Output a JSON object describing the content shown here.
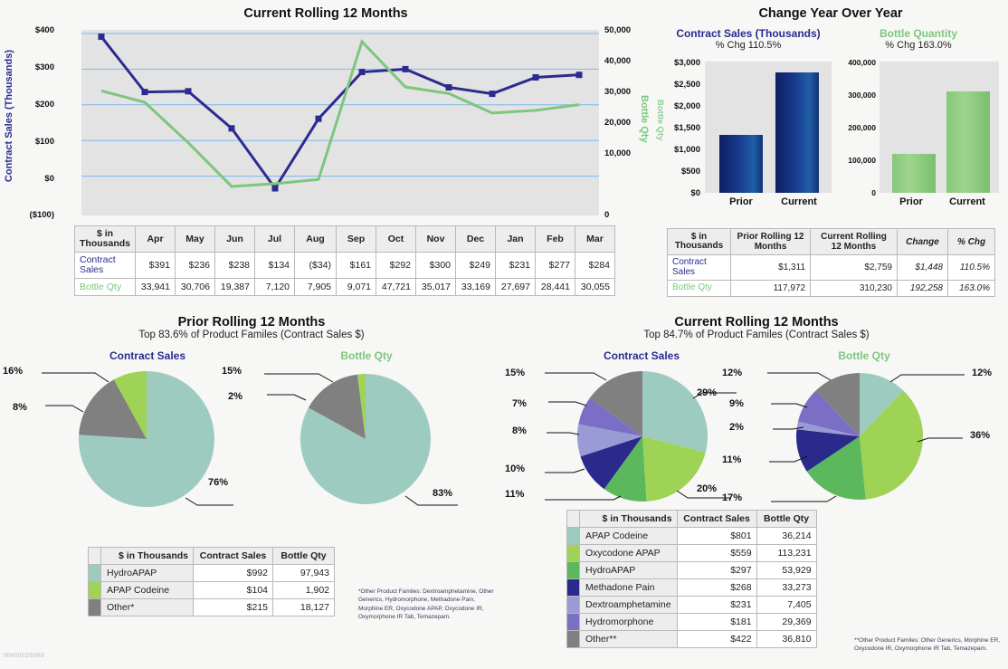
{
  "line_chart": {
    "title": "Current Rolling 12 Months",
    "y_left_label": "Contract Sales (Thousands)",
    "y_right_label": "Bottle Qty",
    "y_left_ticks": [
      "$400",
      "$300",
      "$200",
      "$100",
      "$0",
      "($100)"
    ],
    "y_right_ticks": [
      "50,000",
      "40,000",
      "30,000",
      "20,000",
      "10,000",
      "0"
    ]
  },
  "month_table": {
    "corner": "$ in Thousands",
    "months": [
      "Apr",
      "May",
      "Jun",
      "Jul",
      "Aug",
      "Sep",
      "Oct",
      "Nov",
      "Dec",
      "Jan",
      "Feb",
      "Mar"
    ],
    "rows": [
      {
        "label": "Contract Sales",
        "values": [
          "$391",
          "$236",
          "$238",
          "$134",
          "($34)",
          "$161",
          "$292",
          "$300",
          "$249",
          "$231",
          "$277",
          "$284"
        ]
      },
      {
        "label": "Bottle Qty",
        "values": [
          "33,941",
          "30,706",
          "19,387",
          "7,120",
          "7,905",
          "9,071",
          "47,721",
          "35,017",
          "33,169",
          "27,697",
          "28,441",
          "30,055"
        ]
      }
    ]
  },
  "yoy": {
    "title": "Change Year Over Year",
    "left_chart": {
      "title": "Contract Sales (Thousands)",
      "subtitle": "% Chg 110.5%",
      "ticks": [
        "$3,000",
        "$2,500",
        "$2,000",
        "$1,500",
        "$1,000",
        "$500",
        "$0"
      ],
      "cat_prior": "Prior",
      "cat_current": "Current"
    },
    "right_chart": {
      "title": "Bottle Quantity",
      "subtitle": "% Chg 163.0%",
      "ticks": [
        "400,000",
        "300,000",
        "200,000",
        "100,000",
        "0"
      ],
      "cat_prior": "Prior",
      "cat_current": "Current"
    },
    "side_label": "Bottle Qty",
    "table": {
      "corner": "$ in Thousands",
      "headers": [
        "Prior Rolling 12 Months",
        "Current Rolling 12 Months",
        "Change",
        "% Chg"
      ],
      "rows": [
        {
          "label": "Contract Sales",
          "prior": "$1,311",
          "current": "$2,759",
          "change": "$1,448",
          "pct": "110.5%"
        },
        {
          "label": "Bottle Qty",
          "prior": "117,972",
          "current": "310,230",
          "change": "192,258",
          "pct": "163.0%"
        }
      ]
    }
  },
  "prior": {
    "title": "Prior Rolling 12 Months",
    "subtitle": "Top 83.6% of Product Familes (Contract Sales $)",
    "pie_left_title": "Contract Sales",
    "pie_right_title": "Bottle Qty",
    "labels": {
      "cs_76": "76%",
      "cs_8": "8%",
      "cs_16": "16%",
      "bq_83": "83%",
      "bq_2": "2%",
      "bq_15": "15%"
    },
    "table": {
      "corner": "$ in Thousands",
      "headers": [
        "Contract Sales",
        "Bottle Qty"
      ],
      "rows": [
        {
          "label": "HydroAPAP",
          "sales": "$992",
          "qty": "97,943"
        },
        {
          "label": "APAP Codeine",
          "sales": "$104",
          "qty": "1,902"
        },
        {
          "label": "Other*",
          "sales": "$215",
          "qty": "18,127"
        }
      ]
    },
    "footnote": "*Other Product Familes: Dextroamphetamine, Other Generics, Hydromorphone, Methadone Pain, Morphine ER, Oxycodone APAP, Oxycodone IR, Oxymorphone IR Tab, Temazepam."
  },
  "current": {
    "title": "Current Rolling 12 Months",
    "subtitle": "Top 84.7% of Product Familes (Contract Sales $)",
    "pie_left_title": "Contract Sales",
    "pie_right_title": "Bottle Qty",
    "labels": {
      "cs_29": "29%",
      "cs_20": "20%",
      "cs_11": "11%",
      "cs_10": "10%",
      "cs_8": "8%",
      "cs_7": "7%",
      "cs_15": "15%",
      "bq_12r": "12%",
      "bq_36": "36%",
      "bq_17": "17%",
      "bq_11": "11%",
      "bq_2": "2%",
      "bq_9": "9%",
      "bq_12l": "12%"
    },
    "table": {
      "corner": "$ in Thousands",
      "headers": [
        "Contract Sales",
        "Bottle Qty"
      ],
      "rows": [
        {
          "label": "APAP Codeine",
          "sales": "$801",
          "qty": "36,214"
        },
        {
          "label": "Oxycodone APAP",
          "sales": "$559",
          "qty": "113,231"
        },
        {
          "label": "HydroAPAP",
          "sales": "$297",
          "qty": "53,929"
        },
        {
          "label": "Methadone Pain",
          "sales": "$268",
          "qty": "33,273"
        },
        {
          "label": "Dextroamphetamine",
          "sales": "$231",
          "qty": "7,405"
        },
        {
          "label": "Hydromorphone",
          "sales": "$181",
          "qty": "29,369"
        },
        {
          "label": "Other**",
          "sales": "$422",
          "qty": "36,810"
        }
      ]
    },
    "footnote": "**Other Product Familes: Other Generics, Morphine ER, Oxycodone IR, Oxymorphone IR Tab, Temazepam."
  },
  "watermark": "MN00029088",
  "colors": {
    "series_sales": "#2b2b8f",
    "series_qty": "#7dc67d",
    "pie_hydroapap": "#9ecbc0",
    "pie_apap_codeine": "#9ed356",
    "pie_oxycodone_apap": "#9ed356",
    "pie_hydroapap_cur": "#5cb85c",
    "pie_methadone": "#2a2a8c",
    "pie_dextro": "#9a9ad6",
    "pie_hydromorphone": "#7a6fc4",
    "pie_other": "#808080"
  },
  "chart_data": [
    {
      "type": "line",
      "title": "Current Rolling 12 Months",
      "xlabel": "",
      "ylabel": "Contract Sales (Thousands)",
      "y2label": "Bottle Qty",
      "categories": [
        "Apr",
        "May",
        "Jun",
        "Jul",
        "Aug",
        "Sep",
        "Oct",
        "Nov",
        "Dec",
        "Jan",
        "Feb",
        "Mar"
      ],
      "ylim": [
        -100,
        400
      ],
      "y2lim": [
        0,
        50000
      ],
      "grid": true,
      "legend": "none",
      "series": [
        {
          "name": "Contract Sales",
          "axis": "left",
          "color": "#2b2b8f",
          "values": [
            391,
            236,
            238,
            134,
            -34,
            161,
            292,
            300,
            249,
            231,
            277,
            284
          ]
        },
        {
          "name": "Bottle Qty",
          "axis": "right",
          "color": "#7dc67d",
          "values": [
            33941,
            30706,
            19387,
            7120,
            7905,
            9071,
            47721,
            35017,
            33169,
            27697,
            28441,
            30055
          ]
        }
      ]
    },
    {
      "type": "bar",
      "title": "Contract Sales (Thousands)",
      "subtitle": "% Chg 110.5%",
      "categories": [
        "Prior",
        "Current"
      ],
      "values": [
        1311,
        2759
      ],
      "ylim": [
        0,
        3000
      ],
      "ylabel": "",
      "color": "#15357f"
    },
    {
      "type": "bar",
      "title": "Bottle Quantity",
      "subtitle": "% Chg 163.0%",
      "categories": [
        "Prior",
        "Current"
      ],
      "values": [
        117972,
        310230
      ],
      "ylim": [
        0,
        400000
      ],
      "ylabel": "Bottle Qty",
      "color": "#8dcd80"
    },
    {
      "type": "pie",
      "title": "Prior Rolling 12 Months — Contract Sales",
      "labels": [
        "HydroAPAP",
        "Other*",
        "APAP Codeine"
      ],
      "values": [
        76,
        16,
        8
      ],
      "colors": [
        "#9ecbc0",
        "#808080",
        "#9ed356"
      ]
    },
    {
      "type": "pie",
      "title": "Prior Rolling 12 Months — Bottle Qty",
      "labels": [
        "HydroAPAP",
        "Other*",
        "APAP Codeine"
      ],
      "values": [
        83,
        15,
        2
      ],
      "colors": [
        "#9ecbc0",
        "#808080",
        "#9ed356"
      ]
    },
    {
      "type": "pie",
      "title": "Current Rolling 12 Months — Contract Sales",
      "labels": [
        "APAP Codeine",
        "Oxycodone APAP",
        "HydroAPAP",
        "Methadone Pain",
        "Dextroamphetamine",
        "Hydromorphone",
        "Other**"
      ],
      "values": [
        29,
        20,
        11,
        10,
        8,
        7,
        15
      ],
      "colors": [
        "#9ecbc0",
        "#9ed356",
        "#5cb85c",
        "#2a2a8c",
        "#9a9ad6",
        "#7a6fc4",
        "#808080"
      ]
    },
    {
      "type": "pie",
      "title": "Current Rolling 12 Months — Bottle Qty",
      "labels": [
        "APAP Codeine",
        "Oxycodone APAP",
        "HydroAPAP",
        "Methadone Pain",
        "Dextroamphetamine",
        "Hydromorphone",
        "Other**"
      ],
      "values": [
        12,
        36,
        17,
        11,
        2,
        9,
        12
      ],
      "colors": [
        "#9ecbc0",
        "#9ed356",
        "#5cb85c",
        "#2a2a8c",
        "#9a9ad6",
        "#7a6fc4",
        "#808080"
      ]
    }
  ]
}
